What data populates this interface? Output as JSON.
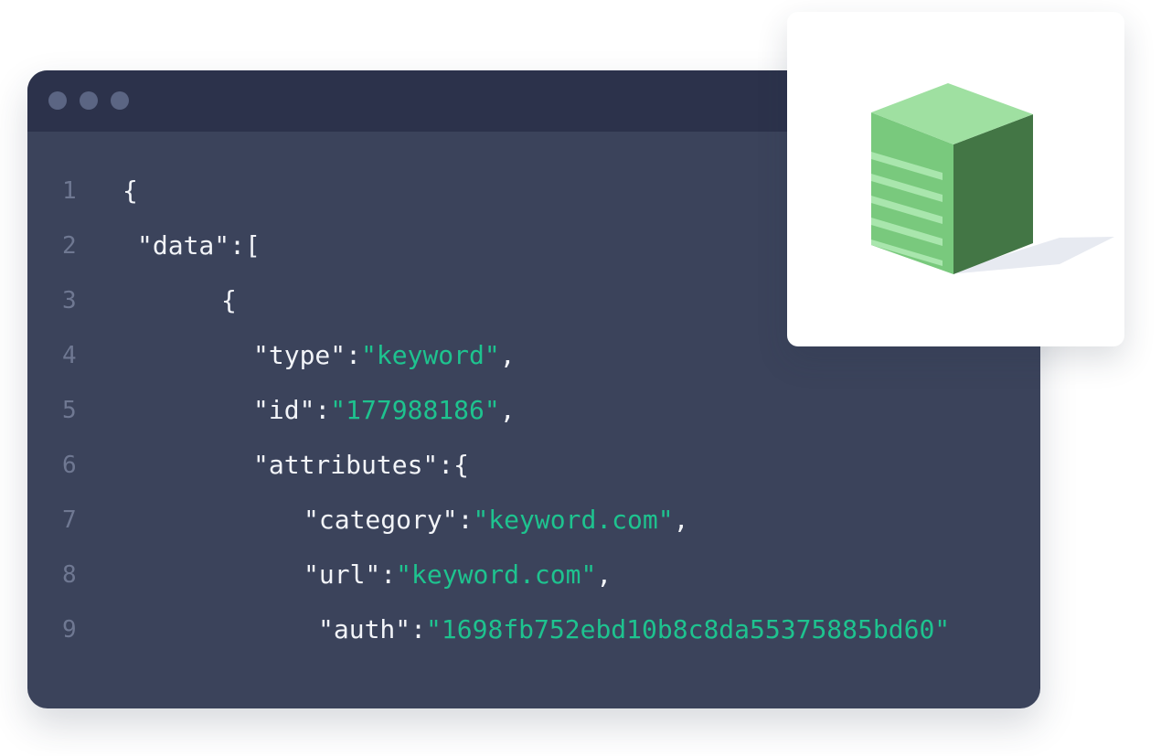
{
  "window": {
    "controls": [
      "window-dot",
      "window-dot",
      "window-dot"
    ]
  },
  "code": {
    "lines": [
      {
        "number": "1",
        "parts": [
          {
            "text": "{",
            "kind": "plain"
          }
        ]
      },
      {
        "number": "2",
        "parts": [
          {
            "text": "\"data\":[",
            "kind": "plain"
          }
        ]
      },
      {
        "number": "3",
        "parts": [
          {
            "text": "{",
            "kind": "plain"
          }
        ]
      },
      {
        "number": "4",
        "parts": [
          {
            "text": "\"type\":",
            "kind": "plain"
          },
          {
            "text": "\"keyword\"",
            "kind": "string"
          },
          {
            "text": ",",
            "kind": "plain"
          }
        ]
      },
      {
        "number": "5",
        "parts": [
          {
            "text": "\"id\":",
            "kind": "plain"
          },
          {
            "text": "\"177988186\"",
            "kind": "string"
          },
          {
            "text": ",",
            "kind": "plain"
          }
        ]
      },
      {
        "number": "6",
        "parts": [
          {
            "text": "\"attributes\":{",
            "kind": "plain"
          }
        ]
      },
      {
        "number": "7",
        "parts": [
          {
            "text": "\"category\":",
            "kind": "plain"
          },
          {
            "text": "\"keyword.com\"",
            "kind": "string"
          },
          {
            "text": ",",
            "kind": "plain"
          }
        ]
      },
      {
        "number": "8",
        "parts": [
          {
            "text": "\"url\":",
            "kind": "plain"
          },
          {
            "text": "\"keyword.com\"",
            "kind": "string"
          },
          {
            "text": ",",
            "kind": "plain"
          }
        ]
      },
      {
        "number": "9",
        "parts": [
          {
            "text": "\"auth\":",
            "kind": "plain"
          },
          {
            "text": "\"1698fb752ebd10b8c8da55375885bd60\"",
            "kind": "string"
          }
        ]
      }
    ]
  },
  "illustration": {
    "icon": "server-box-icon",
    "colors": {
      "top": "#9fe0a1",
      "front": "#79c97d",
      "side": "#437645",
      "slats": "#a9e6ad",
      "shadow": "#e7eaf1"
    }
  },
  "colors": {
    "editor_bg": "#3b435b",
    "titlebar_bg": "#2c324b",
    "dot": "#5b6583",
    "line_number": "#6f7892",
    "text": "#f2f4f8",
    "string": "#1ec38f"
  }
}
